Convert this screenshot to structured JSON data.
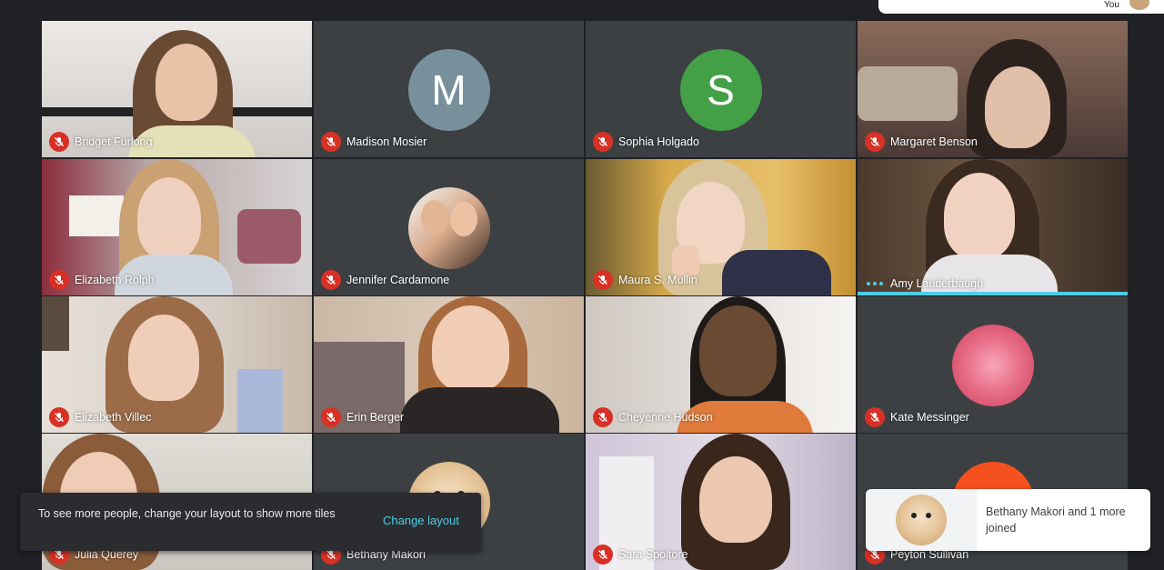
{
  "topbar": {
    "you_label": "You"
  },
  "participants": [
    {
      "name": "Bridget Furlong",
      "muted": true
    },
    {
      "name": "Madison Mosier",
      "muted": true,
      "avatar_letter": "M",
      "avatar_color": "#78909c"
    },
    {
      "name": "Sophia Holgado",
      "muted": true,
      "avatar_letter": "S",
      "avatar_color": "#43a047"
    },
    {
      "name": "Margaret Benson",
      "muted": true
    },
    {
      "name": "Elizabeth Rolph",
      "muted": true
    },
    {
      "name": "Jennifer Cardamone",
      "muted": true
    },
    {
      "name": "Maura S. Mullin",
      "muted": true
    },
    {
      "name": "Amy Lauderbaugh",
      "muted": false,
      "speaking": true
    },
    {
      "name": "Elizabeth Villec",
      "muted": true
    },
    {
      "name": "Erin Berger",
      "muted": true
    },
    {
      "name": "Cheyenne Hudson",
      "muted": true
    },
    {
      "name": "Kate Messinger",
      "muted": true
    },
    {
      "name": "Julia Querey",
      "muted": true
    },
    {
      "name": "Bethany Makori",
      "muted": true
    },
    {
      "name": "Sara Spoltore",
      "muted": true
    },
    {
      "name": "Peyton Sullivan",
      "muted": true,
      "avatar_color": "#f4511e"
    }
  ],
  "layout_toast": {
    "message": "To see more people, change your layout to show more tiles",
    "action": "Change layout"
  },
  "join_toast": {
    "message": "Bethany Makori and 1 more joined"
  },
  "colors": {
    "accent": "#4ecde6",
    "mute_red": "#d93025",
    "background": "#202124"
  }
}
